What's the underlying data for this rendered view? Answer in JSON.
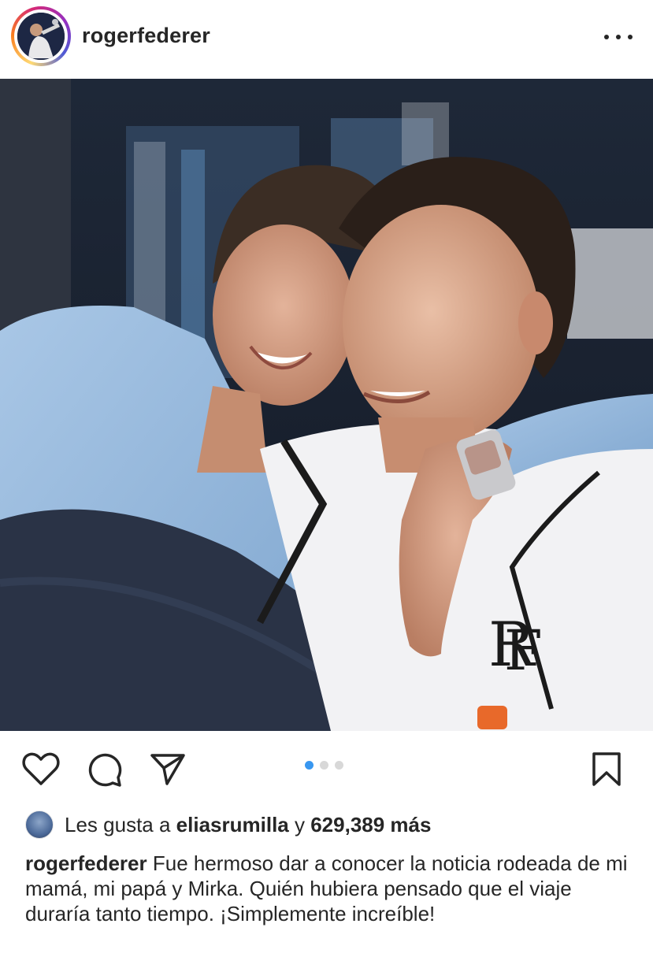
{
  "header": {
    "username": "rogerfederer",
    "avatar_icon": "profile-avatar",
    "more_icon": "more-horizontal-icon"
  },
  "post": {
    "image_alt": "Photo of Roger Federer and Mirka",
    "carousel": {
      "total": 3,
      "active": 1
    }
  },
  "actions": {
    "like_icon": "heart-icon",
    "comment_icon": "comment-icon",
    "share_icon": "paper-plane-icon",
    "save_icon": "bookmark-icon"
  },
  "likes": {
    "prefix": "Les gusta a",
    "user": "eliasrumilla",
    "connector": "y",
    "count": "629,389 más"
  },
  "caption": {
    "user": "rogerfederer",
    "text": "Fue hermoso dar a conocer la noticia rodeada de mi mamá, mi papá y Mirka. Quién hubiera pensado que el viaje duraría tanto tiempo. ¡Simplemente increíble!"
  },
  "colors": {
    "text": "#262626",
    "carousel_active": "#3897f0",
    "carousel_inactive": "#d8d8d8"
  }
}
